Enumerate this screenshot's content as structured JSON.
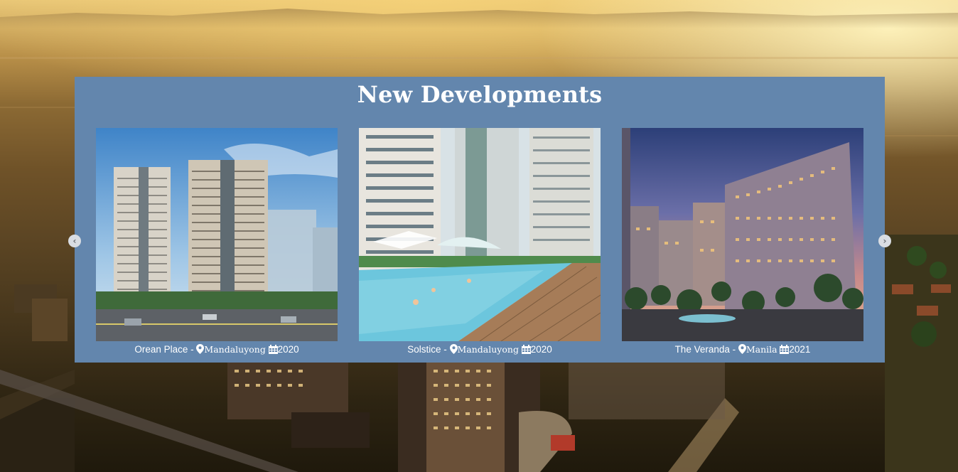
{
  "section": {
    "title": "New Developments"
  },
  "carousel": {
    "prev_icon": "chevron-left-icon",
    "next_icon": "chevron-right-icon",
    "prev_glyph": "‹",
    "next_glyph": "›",
    "cards": [
      {
        "name": "Orean Place",
        "separator": " - ",
        "location": "Mandaluyong",
        "year": "2020"
      },
      {
        "name": "Solstice",
        "separator": " - ",
        "location": "Mandaluyong",
        "year": "2020"
      },
      {
        "name": "The Veranda",
        "separator": " - ",
        "location": "Manila",
        "year": "2021"
      }
    ]
  },
  "colors": {
    "panel_bg": "#6386ad",
    "text": "#ffffff"
  }
}
